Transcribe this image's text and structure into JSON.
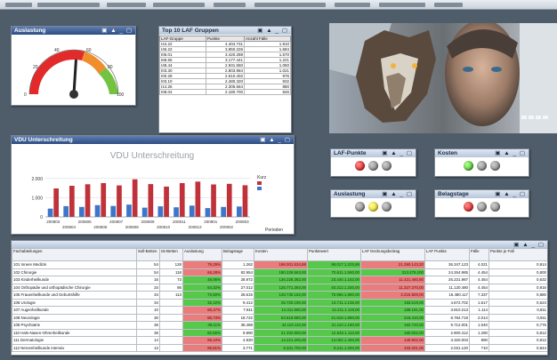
{
  "window": {
    "title": ""
  },
  "panels": {
    "gauge": {
      "title": "Auslastung",
      "ticks": [
        "0",
        "20",
        "40",
        "60",
        "80",
        "100"
      ],
      "value_fraction": 0.52
    },
    "top10": {
      "title": "Top 10 LAF Gruppen",
      "headers": [
        "LAF-Gruppe",
        "Punkte",
        "Anzahl Fälle"
      ],
      "rows": [
        [
          "I44.22",
          "4.404.731",
          "1.910"
        ],
        [
          "I45.22",
          "3.850.226",
          "1.684"
        ],
        [
          "I05.01",
          "3.420.288",
          "1.570"
        ],
        [
          "I68.55",
          "3.177.441",
          "1.221"
        ],
        [
          "I48.44",
          "2.931.550",
          "1.050"
        ],
        [
          "I03.30",
          "2.803.984",
          "1.021"
        ],
        [
          "I00.28",
          "2.610.402",
          "976"
        ],
        [
          "I03.10",
          "2.480.320",
          "932"
        ],
        [
          "I14.26",
          "2.305.664",
          "880"
        ],
        [
          "I08.04",
          "2.180.700",
          "846"
        ]
      ]
    },
    "vdu": {
      "title": "VDU Unterschreitung",
      "legend_title": "Kurz",
      "footer": "Perioden"
    },
    "laf_punkte": {
      "title": "LAF-Punkte",
      "leds": [
        "red",
        "off",
        "off"
      ]
    },
    "kosten": {
      "title": "Kosten",
      "leds": [
        "green",
        "off",
        "off"
      ]
    },
    "auslastung2": {
      "title": "Auslastung",
      "leds": [
        "off",
        "yellow",
        "off"
      ]
    },
    "belagstage": {
      "title": "Belagstage",
      "leds": [
        "red",
        "off",
        "off"
      ]
    },
    "table": {
      "headers": [
        "Fachabteilungen",
        "Soll-Betten",
        "Ist-Betten",
        "Auslastung",
        "Belagstage",
        "Kosten",
        "Punktewert",
        "LAF Deckungsbeitrag",
        "LAF Punkte",
        "Fälle",
        "Punkte je Fall"
      ],
      "rows": [
        {
          "cells": [
            "101 Innere Medizin",
            "54",
            "128",
            "79,29%",
            "1.262",
            "196.001.534,88",
            "98.017.1.225,88",
            "21.390.143,20",
            "36.347.123",
            "4.021",
            "0,914"
          ],
          "col": [
            0,
            0,
            0,
            1,
            0,
            1,
            2,
            1,
            0,
            0,
            0
          ]
        },
        {
          "cells": [
            "102 Chirurgie",
            "54",
            "118",
            "66,28%",
            "82.954",
            "190.228.563,00",
            "70.611.1.590,00",
            "313.279.200",
            "24.264.985",
            "4.454",
            "0,800"
          ],
          "col": [
            0,
            0,
            0,
            1,
            0,
            2,
            2,
            2,
            0,
            0,
            0
          ]
        },
        {
          "cells": [
            "103 Kinderheilkunde",
            "16",
            "73",
            "48,95%",
            "28.972",
            "136.228.382,00",
            "23.440.1.182,00",
            "11.421.460,80",
            "26.231.987",
            "4.454",
            "0,632"
          ],
          "col": [
            0,
            0,
            0,
            2,
            0,
            2,
            2,
            1,
            0,
            0,
            0
          ]
        },
        {
          "cells": [
            "104 Orthopädie und orthopädische Chirurgie",
            "34",
            "86",
            "64,32%",
            "27.012",
            "126.771.393,00",
            "40.212.1.330,00",
            "11.327.370,00",
            "11.120.480",
            "4.454",
            "0,916"
          ],
          "col": [
            0,
            0,
            0,
            2,
            0,
            2,
            2,
            1,
            0,
            0,
            0
          ]
        },
        {
          "cells": [
            "105 Frauenheilkunde und Geburtshilfe",
            "34",
            "113",
            "73,60%",
            "28.615",
            "128.730.182,00",
            "75.966.1.880,00",
            "2.216.829,00",
            "16.480.117",
            "7.337",
            "0,880"
          ],
          "col": [
            0,
            0,
            0,
            2,
            0,
            2,
            2,
            1,
            0,
            0,
            0
          ]
        },
        {
          "cells": [
            "106 Urologie",
            "34",
            "",
            "32,42%",
            "9.412",
            "25.720.190,00",
            "13.711.1.135,00",
            "183.519,00",
            "4.672.702",
            "1.617",
            "0,624"
          ],
          "col": [
            0,
            0,
            0,
            2,
            0,
            2,
            2,
            2,
            0,
            0,
            0
          ]
        },
        {
          "cells": [
            "107 Augenheilkunde",
            "10",
            "",
            "68,47%",
            "7.811",
            "14.411.880,00",
            "12.211.1.119,00",
            "188.191,00",
            "3.810.213",
            "1.114",
            "0,811"
          ],
          "col": [
            0,
            0,
            0,
            1,
            0,
            2,
            2,
            2,
            0,
            0,
            0
          ]
        },
        {
          "cells": [
            "108 Neurologie",
            "30",
            "",
            "88,73%",
            "18.722",
            "54.618.880,00",
            "41.618.1.890,00",
            "218.410,00",
            "8.784.719",
            "2.014",
            "0,911"
          ],
          "col": [
            0,
            0,
            0,
            1,
            0,
            2,
            2,
            2,
            0,
            0,
            0
          ]
        },
        {
          "cells": [
            "109 Psychiatrie",
            "36",
            "",
            "39,11%",
            "38.488",
            "44.119.110,00",
            "21.110.1.180,00",
            "182.720,00",
            "9.712.001",
            "1.040",
            "0,776"
          ],
          "col": [
            0,
            0,
            0,
            2,
            0,
            2,
            2,
            2,
            0,
            0,
            0
          ]
        },
        {
          "cells": [
            "110 Hals-Nasen-Ohrenheilkunde",
            "36",
            "",
            "82,56%",
            "9.890",
            "21.332.800,00",
            "12.640.1.110,00",
            "180.002,00",
            "2.900.412",
            "1.290",
            "0,812"
          ],
          "col": [
            0,
            0,
            0,
            2,
            0,
            2,
            2,
            2,
            0,
            0,
            0
          ]
        },
        {
          "cells": [
            "111 Dermatologie",
            "14",
            "",
            "99,10%",
            "4.830",
            "14.221.200,00",
            "12.002.1.400,00",
            "140.902,00",
            "3.320.003",
            "890",
            "0,912"
          ],
          "col": [
            0,
            0,
            0,
            1,
            0,
            2,
            2,
            1,
            0,
            0,
            0
          ]
        },
        {
          "cells": [
            "112 Nervenheilkunde intensiv",
            "12",
            "",
            "99,81%",
            "3.771",
            "9.331.700,00",
            "8.211.1.200,00",
            "103.201,00",
            "2.031.120",
            "710",
            "0,844"
          ],
          "col": [
            0,
            0,
            0,
            1,
            0,
            2,
            2,
            1,
            0,
            0,
            0
          ]
        }
      ]
    }
  },
  "chart_data": {
    "type": "bar",
    "title": "VDU Unterschreitung",
    "categories": [
      "200803",
      "200804",
      "200805",
      "200806",
      "200807",
      "200808",
      "200809",
      "200810",
      "200811",
      "200812",
      "200901",
      "200902",
      "200903"
    ],
    "series": [
      {
        "name": "",
        "color": "#3d76c9",
        "values": [
          430,
          560,
          520,
          610,
          570,
          640,
          480,
          550,
          500,
          590,
          460,
          520,
          540
        ]
      },
      {
        "name": "",
        "color": "#c0323a",
        "values": [
          1480,
          1620,
          1700,
          1760,
          1640,
          1960,
          1710,
          1580,
          1760,
          1840,
          1690,
          1720,
          1650
        ]
      }
    ],
    "ylim": [
      0,
      2500
    ],
    "yticks": [
      "0",
      "1.000",
      "2.000"
    ],
    "grid": true,
    "legend": "right"
  },
  "colors": {
    "caption": "#2d4c82",
    "background": "#4f5d6a",
    "red_cell": "#ea7c7c",
    "green_cell": "#56c94b"
  }
}
